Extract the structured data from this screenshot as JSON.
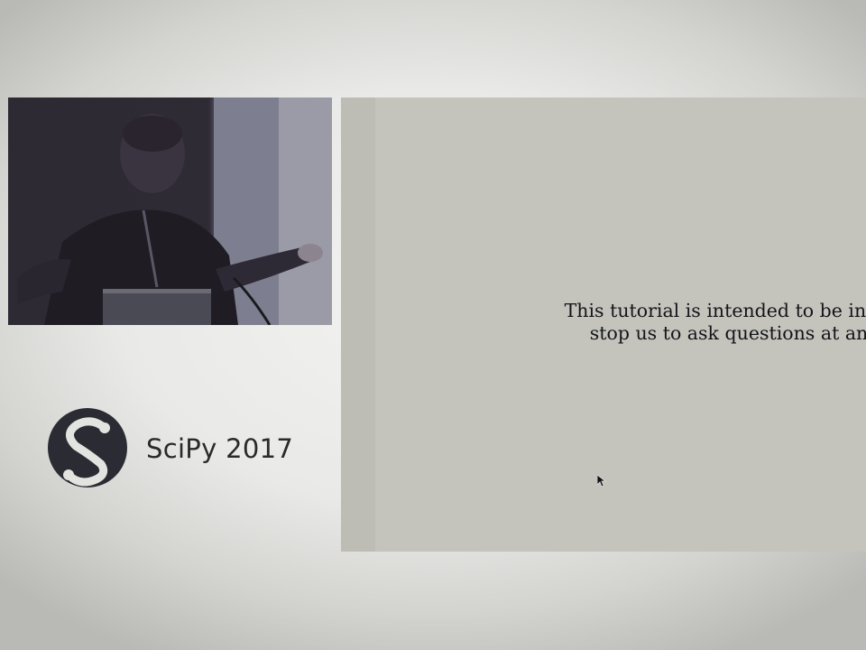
{
  "conference": {
    "name": "SciPy 2017",
    "logo_icon": "scipy-logo-icon"
  },
  "slide": {
    "lines": [
      "This tutorial is intended to be inter",
      "stop us to ask questions at an"
    ]
  },
  "colors": {
    "slide_background": "#c4c4bd",
    "slide_text": "#15151a",
    "logo": "#2b2b33"
  }
}
